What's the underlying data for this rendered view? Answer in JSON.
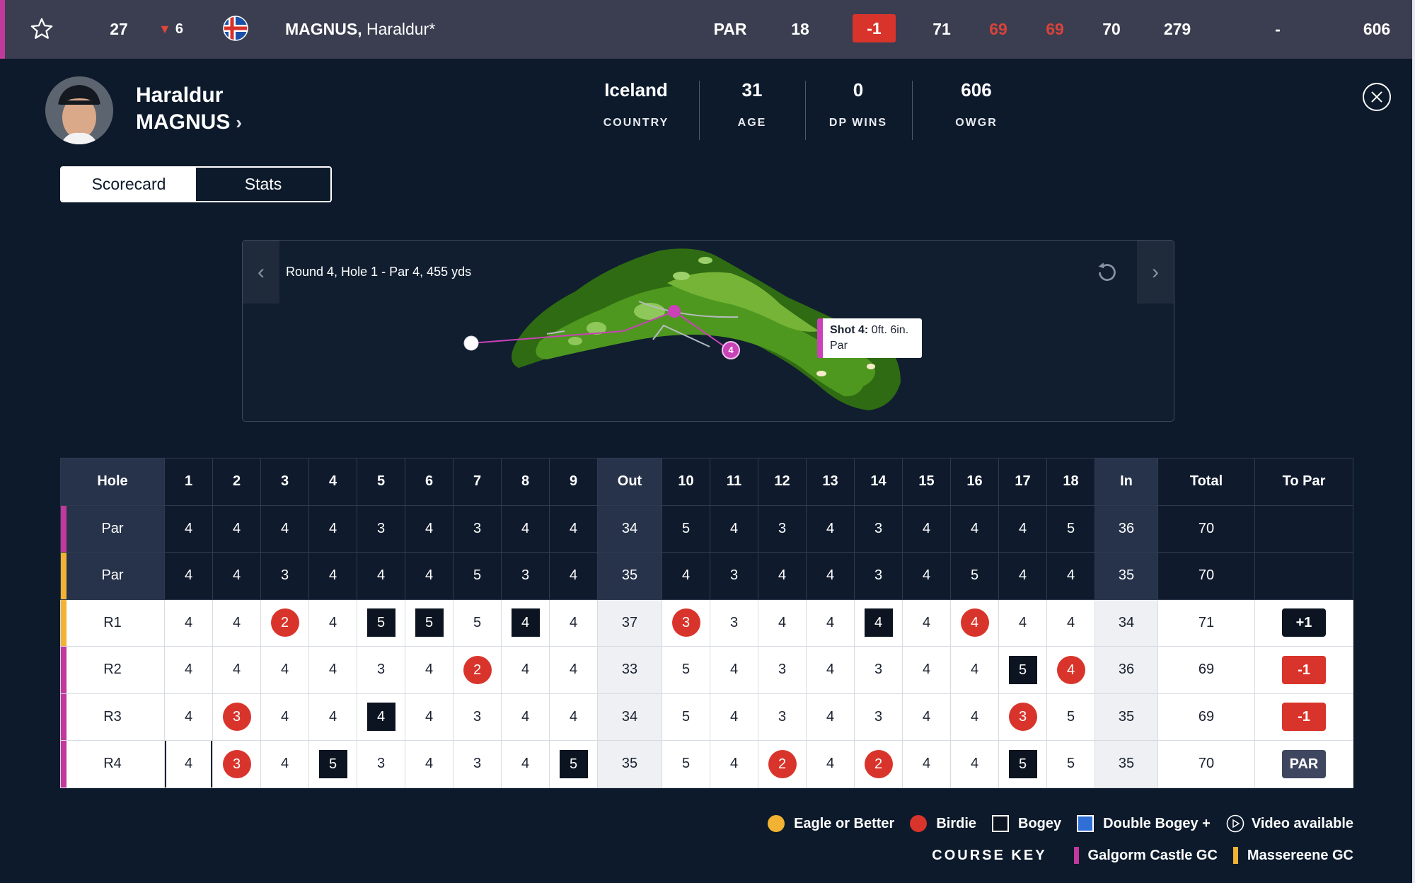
{
  "topbar": {
    "position": "27",
    "movement": "6",
    "player_name_bold": "MAGNUS,",
    "player_name_rest": " Haraldur*",
    "today": "PAR",
    "thru": "18",
    "to_par": "-1",
    "rounds": [
      "71",
      "69",
      "69",
      "70"
    ],
    "total": "279",
    "dash": "-",
    "owgr": "606",
    "colors": {
      "accent": "#c0399b",
      "under_par": "#d9342b"
    }
  },
  "player": {
    "first_name": "Haraldur",
    "last_name": "MAGNUS",
    "stats": [
      {
        "value": "Iceland",
        "label": "COUNTRY"
      },
      {
        "value": "31",
        "label": "AGE"
      },
      {
        "value": "0",
        "label": "DP WINS"
      },
      {
        "value": "606",
        "label": "OWGR"
      }
    ]
  },
  "tabs": {
    "scorecard": "Scorecard",
    "stats": "Stats"
  },
  "holemap": {
    "round_info": "Round 4, Hole 1 - Par 4, 455 yds",
    "shot_title": "Shot 4:",
    "shot_distance": " 0ft. 6in.",
    "shot_result": "Par",
    "shot_marker": "4"
  },
  "scorecard": {
    "header": [
      "Hole",
      "1",
      "2",
      "3",
      "4",
      "5",
      "6",
      "7",
      "8",
      "9",
      "Out",
      "10",
      "11",
      "12",
      "13",
      "14",
      "15",
      "16",
      "17",
      "18",
      "In",
      "Total",
      "To Par"
    ],
    "rows": [
      {
        "course": "mag",
        "type": "par",
        "label": "Par",
        "cells": [
          "4",
          "4",
          "4",
          "4",
          "3",
          "4",
          "3",
          "4",
          "4",
          "34",
          "5",
          "4",
          "3",
          "4",
          "3",
          "4",
          "4",
          "4",
          "5",
          "36",
          "70",
          ""
        ],
        "styles": []
      },
      {
        "course": "yel",
        "type": "par",
        "label": "Par",
        "cells": [
          "4",
          "4",
          "3",
          "4",
          "4",
          "4",
          "5",
          "3",
          "4",
          "35",
          "4",
          "3",
          "4",
          "4",
          "3",
          "4",
          "5",
          "4",
          "4",
          "35",
          "70",
          ""
        ],
        "styles": []
      },
      {
        "course": "yel",
        "type": "round",
        "label": "R1",
        "cells": [
          "4",
          "4",
          "2",
          "4",
          "5",
          "5",
          "5",
          "4",
          "4",
          "37",
          "3",
          "3",
          "4",
          "4",
          "4",
          "4",
          "4",
          "4",
          "4",
          "34",
          "71",
          "+1"
        ],
        "styles": [
          "",
          "",
          "c",
          "",
          "s",
          "s",
          "",
          "s",
          "",
          "",
          "c",
          "",
          "",
          "",
          "s",
          "",
          "c",
          "",
          "",
          "",
          "",
          "over"
        ]
      },
      {
        "course": "mag",
        "type": "round",
        "label": "R2",
        "cells": [
          "4",
          "4",
          "4",
          "4",
          "3",
          "4",
          "2",
          "4",
          "4",
          "33",
          "5",
          "4",
          "3",
          "4",
          "3",
          "4",
          "4",
          "5",
          "4",
          "36",
          "69",
          "-1"
        ],
        "styles": [
          "",
          "",
          "",
          "",
          "",
          "",
          "c",
          "",
          "",
          "",
          "",
          "",
          "",
          "",
          "",
          "",
          "",
          "s",
          "c",
          "",
          "",
          "under"
        ]
      },
      {
        "course": "mag",
        "type": "round",
        "label": "R3",
        "cells": [
          "4",
          "3",
          "4",
          "4",
          "4",
          "4",
          "3",
          "4",
          "4",
          "34",
          "5",
          "4",
          "3",
          "4",
          "3",
          "4",
          "4",
          "3",
          "5",
          "35",
          "69",
          "-1"
        ],
        "styles": [
          "",
          "c",
          "",
          "",
          "s",
          "",
          "",
          "",
          "",
          "",
          "",
          "",
          "",
          "",
          "",
          "",
          "",
          "c",
          "",
          "",
          "",
          "under"
        ]
      },
      {
        "course": "mag",
        "type": "round",
        "label": "R4",
        "current_hole": 0,
        "cells": [
          "4",
          "3",
          "4",
          "5",
          "3",
          "4",
          "3",
          "4",
          "5",
          "35",
          "5",
          "4",
          "2",
          "4",
          "2",
          "4",
          "4",
          "5",
          "5",
          "35",
          "70",
          "PAR"
        ],
        "styles": [
          "",
          "c",
          "",
          "s",
          "",
          "",
          "",
          "",
          "s",
          "",
          "",
          "",
          "c",
          "",
          "c",
          "",
          "",
          "s",
          "",
          "",
          "",
          "even"
        ]
      }
    ]
  },
  "legend": {
    "items": [
      {
        "label": "Eagle or Better",
        "color": "#f2b233",
        "shape": "circle"
      },
      {
        "label": "Birdie",
        "color": "#d9342b",
        "shape": "circle"
      },
      {
        "label": "Bogey",
        "color": "#0b1420",
        "shape": "square"
      },
      {
        "label": "Double Bogey +",
        "color": "#2f6fd6",
        "shape": "square"
      },
      {
        "label": "Video available",
        "color": "#ffffff",
        "shape": "play"
      }
    ],
    "course_key_title": "COURSE KEY",
    "courses": [
      {
        "label": "Galgorm Castle GC",
        "color": "#c0399b"
      },
      {
        "label": "Massereene GC",
        "color": "#f2b233"
      }
    ]
  }
}
